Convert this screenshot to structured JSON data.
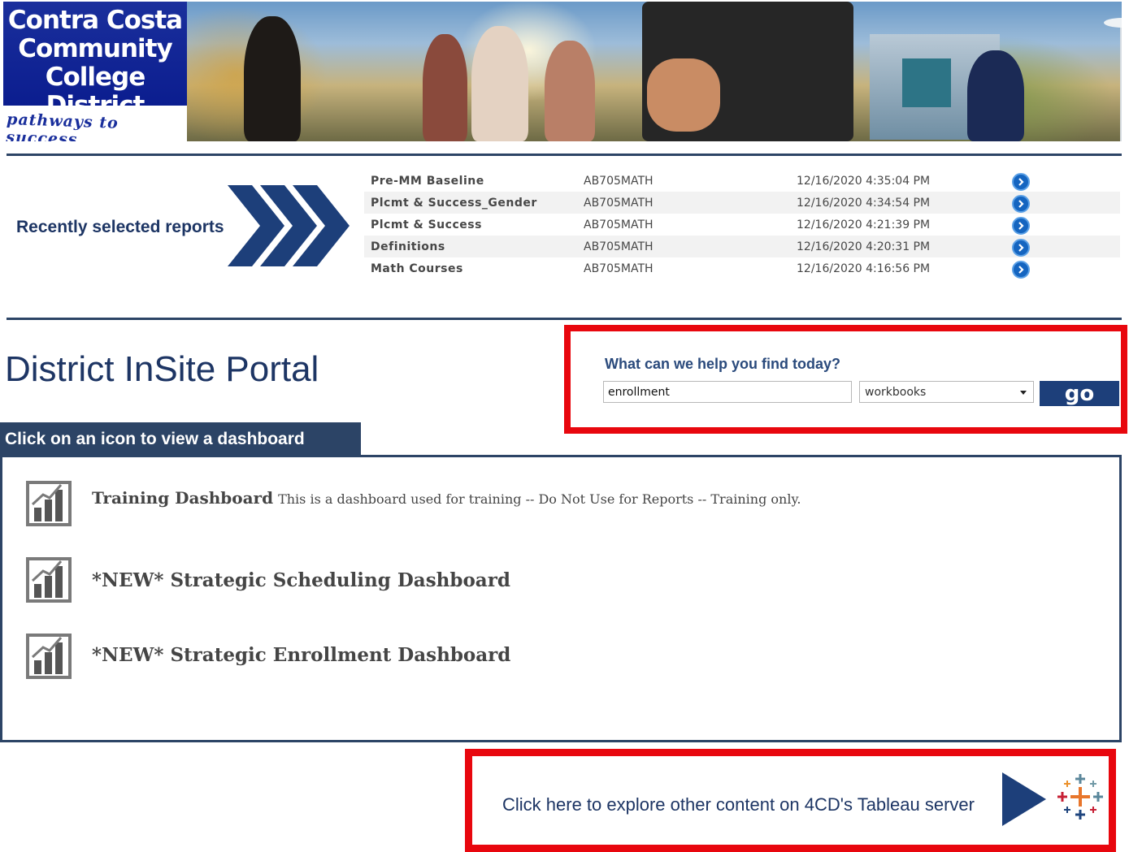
{
  "banner": {
    "logo_line1": "Contra Costa",
    "logo_line2": "Community",
    "logo_line3": "College District",
    "tagline": "pathways to success"
  },
  "recent": {
    "label": "Recently selected reports",
    "reports": [
      {
        "name": "Pre-MM Baseline",
        "user": "AB705MATH",
        "date": "12/16/2020 4:35:04 PM"
      },
      {
        "name": "Plcmt & Success_Gender",
        "user": "AB705MATH",
        "date": "12/16/2020 4:34:54 PM"
      },
      {
        "name": "Plcmt & Success",
        "user": "AB705MATH",
        "date": "12/16/2020 4:21:39 PM"
      },
      {
        "name": "Definitions",
        "user": "AB705MATH",
        "date": "12/16/2020 4:20:31 PM"
      },
      {
        "name": "Math Courses",
        "user": "AB705MATH",
        "date": "12/16/2020 4:16:56 PM"
      }
    ]
  },
  "portal": {
    "title": "District InSite Portal"
  },
  "search": {
    "prompt": "What can we help you find today?",
    "value": "enrollment",
    "type_selected": "workbooks",
    "go_label": "go"
  },
  "dashboards": {
    "tab_label": "Click on an icon to view a dashboard",
    "items": [
      {
        "title": "Training Dashboard",
        "description": "This is a dashboard used for training -- Do Not Use for Reports -- Training only."
      },
      {
        "title": "*NEW* Strategic Scheduling Dashboard",
        "description": ""
      },
      {
        "title": "*NEW* Strategic Enrollment Dashboard",
        "description": ""
      }
    ]
  },
  "explore": {
    "text": "Click here to explore other content on 4CD's Tableau server"
  },
  "colors": {
    "navy": "#2c4466",
    "highlight_red": "#e8070e",
    "go_blue": "#1d3f7a",
    "arrow_blue": "#1565c0"
  },
  "icons": [
    "chevrons-right-icon",
    "circle-arrow-right-icon",
    "bar-chart-icon",
    "play-icon",
    "tableau-logo-icon",
    "chevron-down-icon"
  ]
}
